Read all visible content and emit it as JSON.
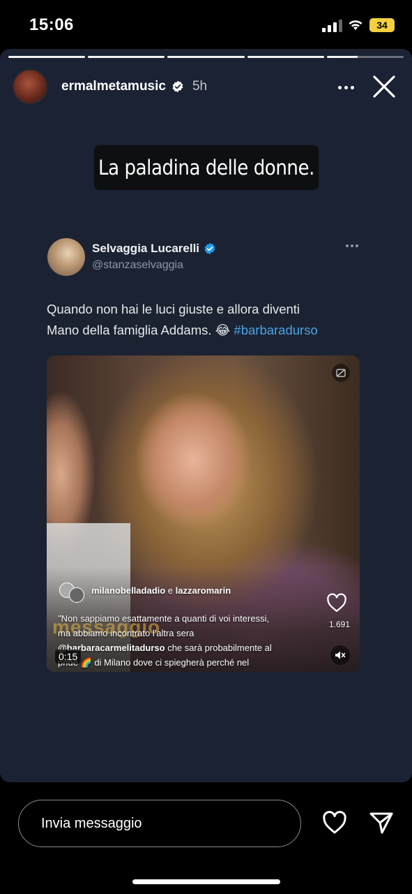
{
  "status_bar": {
    "time": "15:06",
    "battery": "34"
  },
  "story": {
    "username": "ermalmetamusic",
    "time_ago": "5h",
    "caption": "La paladina delle donne.",
    "progress_segments": 5,
    "progress_current_index": 4
  },
  "tweet": {
    "name": "Selvaggia Lucarelli",
    "handle": "@stanzaselvaggia",
    "text_line1": "Quando non hai le luci giuste e allora diventi",
    "text_line2": "Mano della famiglia Addams. 😂 ",
    "hashtag": "#barbaradurso",
    "media": {
      "tagged_user1": "milanobelladadio",
      "tagged_and": " e ",
      "tagged_user2": "lazzaromarin",
      "caption_line1": "\"Non sappiamo esattamente a quanti di voi interessi,",
      "caption_line2": "ma abbiamo incontrato l'altra sera",
      "caption_mention": "@barbaracarmelitadurso",
      "caption_line3_rest": " che sarà probabilmente al",
      "caption_line4": "pride 🌈 di Milano dove ci spiegherà perché nel",
      "likes": "1.691",
      "duration": "0:15",
      "watermark": "messaggio"
    }
  },
  "reply": {
    "placeholder": "Invia messaggio"
  },
  "colors": {
    "story_bg": "#1a2233",
    "hashtag": "#4aa3e8",
    "verified": "#1d9bf0",
    "battery": "#f4d03f"
  },
  "icons": {
    "verified": "verified-badge-icon",
    "more": "more-options-icon",
    "close": "close-icon",
    "heart": "heart-icon",
    "send": "paper-plane-icon",
    "mute": "speaker-muted-icon",
    "captions": "captions-off-icon"
  }
}
